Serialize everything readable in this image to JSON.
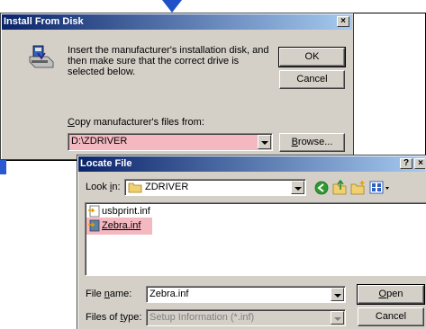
{
  "install_dialog": {
    "title": "Install From Disk",
    "close_glyph": "×",
    "message": "Insert the manufacturer's installation disk, and then make sure that the correct drive is selected below.",
    "ok_label": "OK",
    "cancel_label": "Cancel",
    "copy_label_first": "C",
    "copy_label_rest": "opy manufacturer's files from:",
    "path_value": "D:\\ZDRIVER",
    "browse_label_first": "B",
    "browse_label_rest": "rowse..."
  },
  "locate_dialog": {
    "title": "Locate File",
    "help_glyph": "?",
    "close_glyph": "×",
    "look_in_label_pre": "Look ",
    "look_in_label_key": "i",
    "look_in_label_post": "n:",
    "look_in_value": "ZDRIVER",
    "files": [
      {
        "name": "usbprint.inf",
        "selected": false
      },
      {
        "name": "Zebra.inf",
        "selected": true
      }
    ],
    "filename_label_pre": "File ",
    "filename_label_key": "n",
    "filename_label_post": "ame:",
    "filename_value": "Zebra.inf",
    "filetype_label_pre": "Files of ",
    "filetype_label_key": "t",
    "filetype_label_post": "ype:",
    "filetype_value": "Setup Information (*.inf)",
    "open_label_first": "O",
    "open_label_rest": "pen",
    "cancel_label": "Cancel"
  },
  "colors": {
    "highlight_pink": "#f4b8c0",
    "title_blue": "#0a246a",
    "accent_blue": "#2a58d0"
  }
}
